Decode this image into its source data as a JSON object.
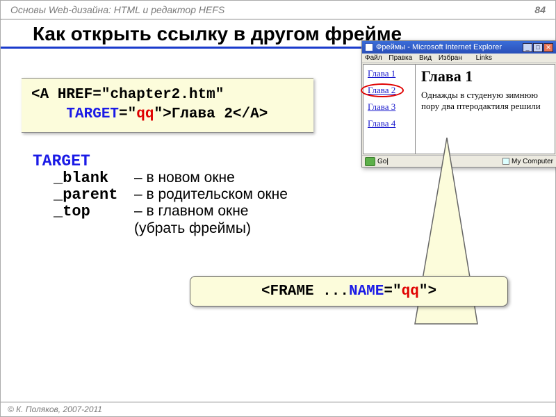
{
  "header": {
    "title": "Основы Web-дизайна: HTML и редактор HEFS",
    "page_num": "84"
  },
  "main_title": "Как открыть ссылку в другом фрейме",
  "code_box": {
    "lt1": "<",
    "a": "A",
    "sp": " ",
    "href": "HREF",
    "eq": "=",
    "q": "\"",
    "href_val": "chapter2.htm",
    "nl_pad": "    ",
    "target": "TARGET",
    "target_val": "qq",
    "gt": ">",
    "link_text": "Глава 2",
    "close": "</A>"
  },
  "target_doc": {
    "keyword": "TARGET",
    "rows": [
      {
        "key": "_blank",
        "desc": "– в новом окне"
      },
      {
        "key": "_parent",
        "desc": "– в родительском окне"
      },
      {
        "key": "_top",
        "desc": "– в главном окне"
      }
    ],
    "extra": "(убрать фреймы)"
  },
  "callout": {
    "lt": "<",
    "frame": "FRAME ... ",
    "name": "NAME",
    "eq": "=",
    "q": "\"",
    "val": "qq",
    "gt": ">"
  },
  "browser": {
    "title": "Фреймы - Microsoft Internet Explorer",
    "menu": [
      "Файл",
      "Правка",
      "Вид",
      "Избран"
    ],
    "links_label": "Links",
    "nav": [
      "Глава 1",
      "Глава 2",
      "Глава 3",
      "Глава 4"
    ],
    "heading": "Глава 1",
    "paragraph": "Однажды в студеную зимнюю пору два птеродактиля решили",
    "status_go": "Go|",
    "status_right": "My Computer"
  },
  "win_btns": {
    "min": "_",
    "max": "□",
    "close": "✕"
  },
  "footer": "© К. Поляков, 2007-2011"
}
